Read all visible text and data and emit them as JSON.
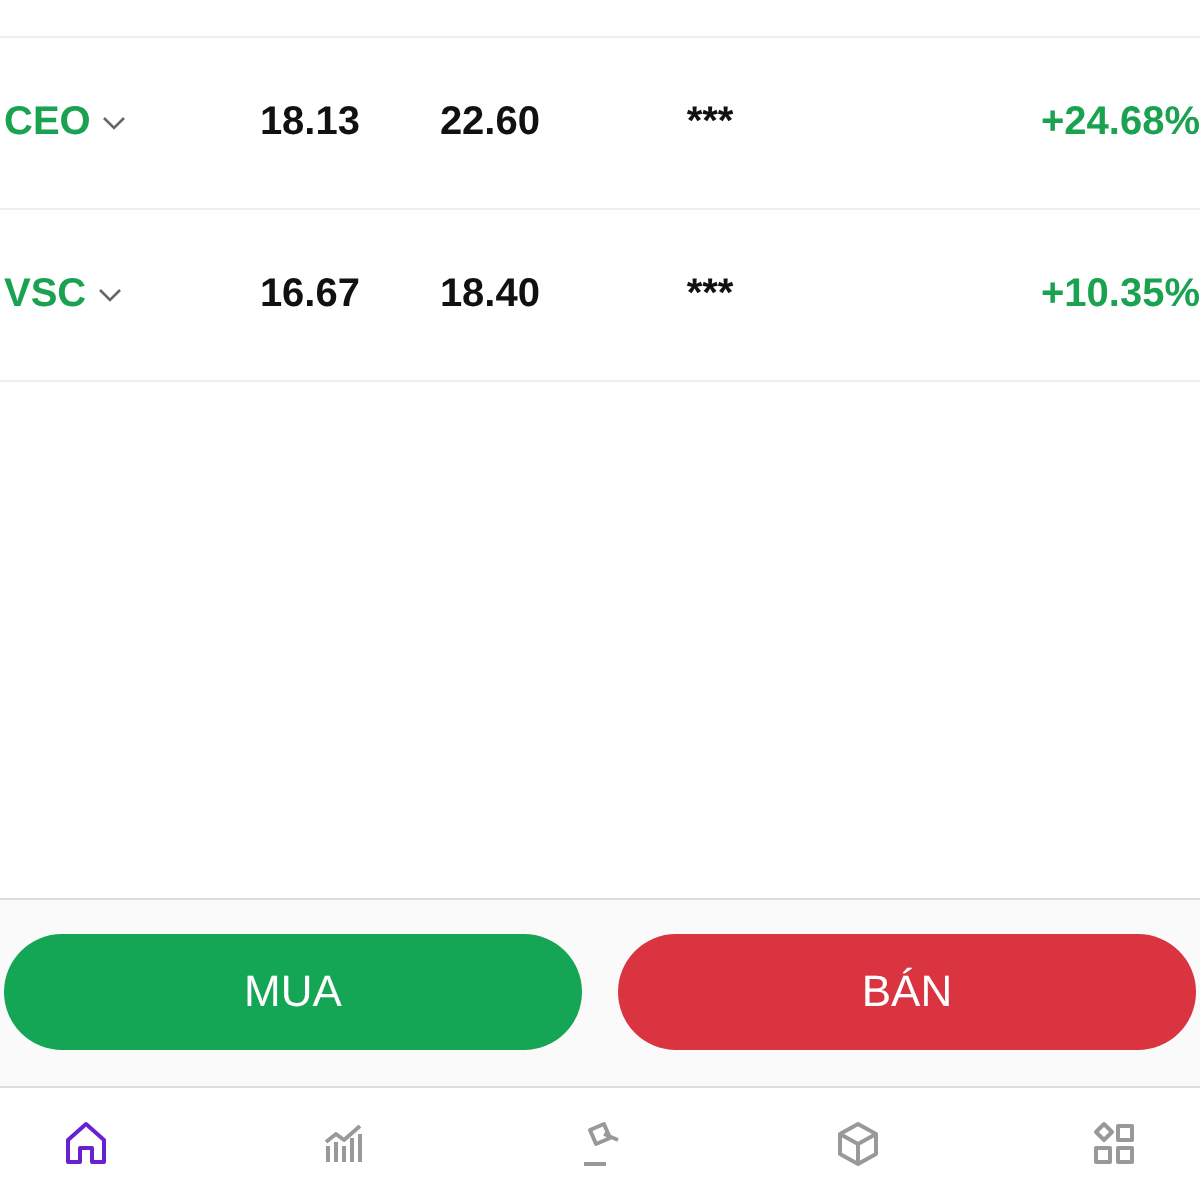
{
  "rows": [
    {
      "symbol": "CEO",
      "col_2": "18.13",
      "col_3": "22.60",
      "col_4": "***",
      "change": "+24.68%"
    },
    {
      "symbol": "VSC",
      "col_2": "16.67",
      "col_3": "18.40",
      "col_4": "***",
      "change": "+10.35%"
    }
  ],
  "actions": [
    {
      "kind": "buy",
      "label": "MUA"
    },
    {
      "kind": "sell",
      "label": "BÁN"
    }
  ],
  "nav": [
    {
      "kind": "home",
      "selected": true
    },
    {
      "kind": "chart",
      "selected": false
    },
    {
      "kind": "auction",
      "selected": false
    },
    {
      "kind": "box",
      "selected": false
    },
    {
      "kind": "apps",
      "selected": false
    }
  ]
}
